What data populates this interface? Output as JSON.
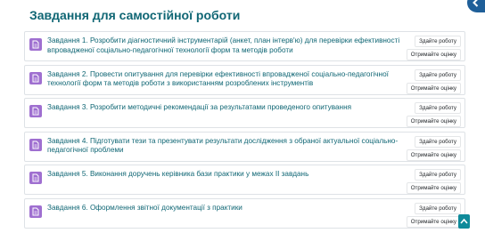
{
  "section": {
    "title": "Завдання для самостійної роботи"
  },
  "tasks": [
    {
      "title": "Завдання 1. Розробити діагностичний інструментарій (анкет, план інтерв'ю) для перевірки ефективності впровадженої соціально-педагогічної технології форм та методів роботи",
      "done_label": "Здайте роботу",
      "grade_label": "Отримайте оцінку"
    },
    {
      "title": "Завдання 2. Провести опитування для перевірки ефективності впровадженої соціально-педагогічної технології форм та методів роботи з використанням розроблених інструментів",
      "done_label": "Здайте роботу",
      "grade_label": "Отримайте оцінку"
    },
    {
      "title": "Завдання 3. Розробити методичні рекомендації за результатами проведеного опитування",
      "done_label": "Здайте роботу",
      "grade_label": "Отримайте оцінку"
    },
    {
      "title": "Завдання 4. Підготувати тези та презентувати результати дослідження з обраної актуальної соціально-педагогічної проблеми",
      "done_label": "Здайте роботу",
      "grade_label": "Отримайте оцінку"
    },
    {
      "title": "Завдання 5. Виконання доручень керівника бази практики у межах ІІ завдань",
      "done_label": "Здайте роботу",
      "grade_label": "Отримайте оцінку"
    },
    {
      "title": "Завдання 6. Оформлення звітної документації з практики",
      "done_label": "Здайте роботу",
      "grade_label": "Отримайте оцінку"
    }
  ],
  "icons": {
    "task": "assignment-icon",
    "collapse": "chevron-left-icon",
    "scroll_top": "chevron-up-icon"
  },
  "colors": {
    "title": "#0f6674",
    "assignment_icon": "#9f6fd0",
    "collapse_button": "#1f5f99",
    "scroll_top_button": "#0f8a9a"
  }
}
